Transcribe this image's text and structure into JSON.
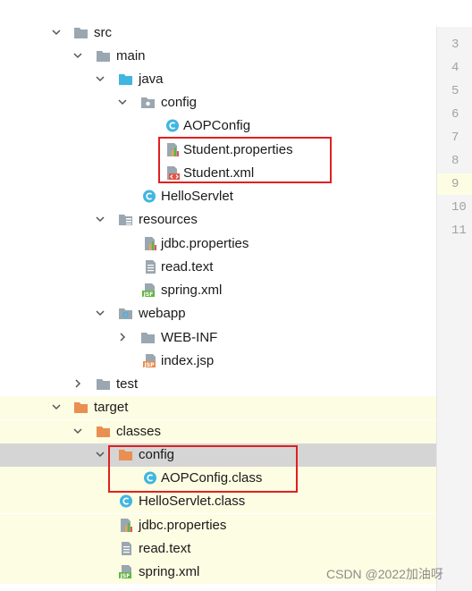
{
  "tree": [
    {
      "label": "src",
      "icon": "folder-icon",
      "expanded": true
    },
    {
      "label": "main",
      "icon": "folder-icon",
      "expanded": true
    },
    {
      "label": "java",
      "icon": "source-folder-icon",
      "expanded": true
    },
    {
      "label": "config",
      "icon": "package-icon",
      "expanded": true
    },
    {
      "label": "AOPConfig",
      "icon": "class-icon"
    },
    {
      "label": "Student.properties",
      "icon": "properties-file-icon"
    },
    {
      "label": "Student.xml",
      "icon": "xml-file-icon"
    },
    {
      "label": "HelloServlet",
      "icon": "class-icon"
    },
    {
      "label": "resources",
      "icon": "resources-folder-icon",
      "expanded": true
    },
    {
      "label": "jdbc.properties",
      "icon": "properties-file-icon"
    },
    {
      "label": "read.text",
      "icon": "text-file-icon"
    },
    {
      "label": "spring.xml",
      "icon": "jsf-file-icon"
    },
    {
      "label": "webapp",
      "icon": "web-folder-icon",
      "expanded": true
    },
    {
      "label": "WEB-INF",
      "icon": "folder-icon",
      "expanded": false
    },
    {
      "label": "index.jsp",
      "icon": "jsp-file-icon"
    },
    {
      "label": "test",
      "icon": "folder-icon",
      "expanded": false
    },
    {
      "label": "target",
      "icon": "excluded-folder-icon",
      "expanded": true
    },
    {
      "label": "classes",
      "icon": "excluded-folder-icon",
      "expanded": true
    },
    {
      "label": "config",
      "icon": "excluded-folder-icon",
      "expanded": true,
      "selected": true
    },
    {
      "label": "AOPConfig.class",
      "icon": "class-icon"
    },
    {
      "label": "HelloServlet.class",
      "icon": "class-icon"
    },
    {
      "label": "jdbc.properties",
      "icon": "properties-file-icon"
    },
    {
      "label": "read.text",
      "icon": "text-file-icon"
    },
    {
      "label": "spring.xml",
      "icon": "jsf-file-icon"
    }
  ],
  "gutter": {
    "lines": [
      "3",
      "4",
      "5",
      "6",
      "7",
      "8",
      "9",
      "10",
      "11"
    ]
  },
  "watermark": "CSDN @2022加油呀",
  "colors": {
    "highlight_box": "#e02020",
    "excluded_highlight": "#fdfde3",
    "selection": "#d5d5d5",
    "folder": "#9aa7b0",
    "source_folder": "#40b6e0",
    "excluded_folder": "#e88f51",
    "class_icon": "#40b6e0"
  }
}
